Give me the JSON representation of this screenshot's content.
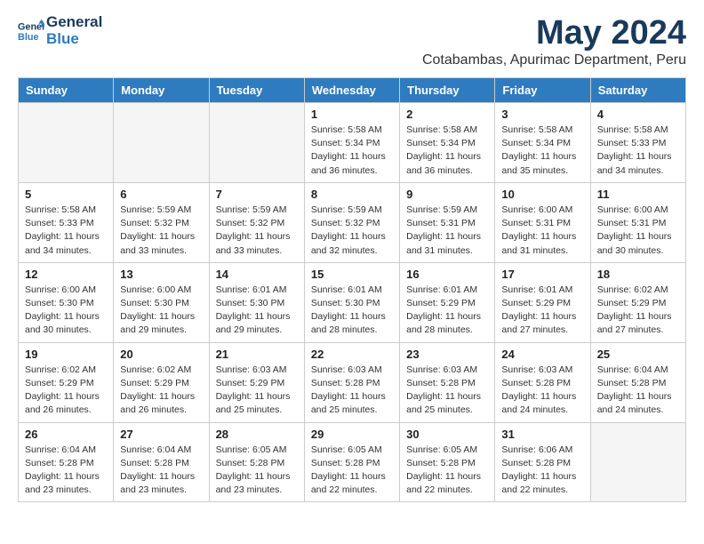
{
  "logo": {
    "line1": "General",
    "line2": "Blue"
  },
  "title": "May 2024",
  "subtitle": "Cotabambas, Apurimac Department, Peru",
  "days_of_week": [
    "Sunday",
    "Monday",
    "Tuesday",
    "Wednesday",
    "Thursday",
    "Friday",
    "Saturday"
  ],
  "weeks": [
    [
      {
        "day": "",
        "info": ""
      },
      {
        "day": "",
        "info": ""
      },
      {
        "day": "",
        "info": ""
      },
      {
        "day": "1",
        "info": "Sunrise: 5:58 AM\nSunset: 5:34 PM\nDaylight: 11 hours\nand 36 minutes."
      },
      {
        "day": "2",
        "info": "Sunrise: 5:58 AM\nSunset: 5:34 PM\nDaylight: 11 hours\nand 36 minutes."
      },
      {
        "day": "3",
        "info": "Sunrise: 5:58 AM\nSunset: 5:34 PM\nDaylight: 11 hours\nand 35 minutes."
      },
      {
        "day": "4",
        "info": "Sunrise: 5:58 AM\nSunset: 5:33 PM\nDaylight: 11 hours\nand 34 minutes."
      }
    ],
    [
      {
        "day": "5",
        "info": "Sunrise: 5:58 AM\nSunset: 5:33 PM\nDaylight: 11 hours\nand 34 minutes."
      },
      {
        "day": "6",
        "info": "Sunrise: 5:59 AM\nSunset: 5:32 PM\nDaylight: 11 hours\nand 33 minutes."
      },
      {
        "day": "7",
        "info": "Sunrise: 5:59 AM\nSunset: 5:32 PM\nDaylight: 11 hours\nand 33 minutes."
      },
      {
        "day": "8",
        "info": "Sunrise: 5:59 AM\nSunset: 5:32 PM\nDaylight: 11 hours\nand 32 minutes."
      },
      {
        "day": "9",
        "info": "Sunrise: 5:59 AM\nSunset: 5:31 PM\nDaylight: 11 hours\nand 31 minutes."
      },
      {
        "day": "10",
        "info": "Sunrise: 6:00 AM\nSunset: 5:31 PM\nDaylight: 11 hours\nand 31 minutes."
      },
      {
        "day": "11",
        "info": "Sunrise: 6:00 AM\nSunset: 5:31 PM\nDaylight: 11 hours\nand 30 minutes."
      }
    ],
    [
      {
        "day": "12",
        "info": "Sunrise: 6:00 AM\nSunset: 5:30 PM\nDaylight: 11 hours\nand 30 minutes."
      },
      {
        "day": "13",
        "info": "Sunrise: 6:00 AM\nSunset: 5:30 PM\nDaylight: 11 hours\nand 29 minutes."
      },
      {
        "day": "14",
        "info": "Sunrise: 6:01 AM\nSunset: 5:30 PM\nDaylight: 11 hours\nand 29 minutes."
      },
      {
        "day": "15",
        "info": "Sunrise: 6:01 AM\nSunset: 5:30 PM\nDaylight: 11 hours\nand 28 minutes."
      },
      {
        "day": "16",
        "info": "Sunrise: 6:01 AM\nSunset: 5:29 PM\nDaylight: 11 hours\nand 28 minutes."
      },
      {
        "day": "17",
        "info": "Sunrise: 6:01 AM\nSunset: 5:29 PM\nDaylight: 11 hours\nand 27 minutes."
      },
      {
        "day": "18",
        "info": "Sunrise: 6:02 AM\nSunset: 5:29 PM\nDaylight: 11 hours\nand 27 minutes."
      }
    ],
    [
      {
        "day": "19",
        "info": "Sunrise: 6:02 AM\nSunset: 5:29 PM\nDaylight: 11 hours\nand 26 minutes."
      },
      {
        "day": "20",
        "info": "Sunrise: 6:02 AM\nSunset: 5:29 PM\nDaylight: 11 hours\nand 26 minutes."
      },
      {
        "day": "21",
        "info": "Sunrise: 6:03 AM\nSunset: 5:29 PM\nDaylight: 11 hours\nand 25 minutes."
      },
      {
        "day": "22",
        "info": "Sunrise: 6:03 AM\nSunset: 5:28 PM\nDaylight: 11 hours\nand 25 minutes."
      },
      {
        "day": "23",
        "info": "Sunrise: 6:03 AM\nSunset: 5:28 PM\nDaylight: 11 hours\nand 25 minutes."
      },
      {
        "day": "24",
        "info": "Sunrise: 6:03 AM\nSunset: 5:28 PM\nDaylight: 11 hours\nand 24 minutes."
      },
      {
        "day": "25",
        "info": "Sunrise: 6:04 AM\nSunset: 5:28 PM\nDaylight: 11 hours\nand 24 minutes."
      }
    ],
    [
      {
        "day": "26",
        "info": "Sunrise: 6:04 AM\nSunset: 5:28 PM\nDaylight: 11 hours\nand 23 minutes."
      },
      {
        "day": "27",
        "info": "Sunrise: 6:04 AM\nSunset: 5:28 PM\nDaylight: 11 hours\nand 23 minutes."
      },
      {
        "day": "28",
        "info": "Sunrise: 6:05 AM\nSunset: 5:28 PM\nDaylight: 11 hours\nand 23 minutes."
      },
      {
        "day": "29",
        "info": "Sunrise: 6:05 AM\nSunset: 5:28 PM\nDaylight: 11 hours\nand 22 minutes."
      },
      {
        "day": "30",
        "info": "Sunrise: 6:05 AM\nSunset: 5:28 PM\nDaylight: 11 hours\nand 22 minutes."
      },
      {
        "day": "31",
        "info": "Sunrise: 6:06 AM\nSunset: 5:28 PM\nDaylight: 11 hours\nand 22 minutes."
      },
      {
        "day": "",
        "info": ""
      }
    ]
  ]
}
